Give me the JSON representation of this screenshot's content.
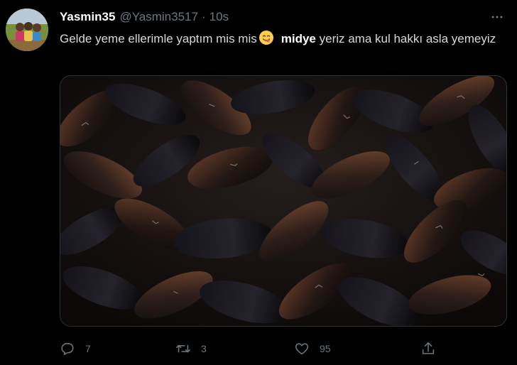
{
  "tweet": {
    "display_name": "Yasmin35",
    "handle": "@Yasmin3517",
    "separator": "·",
    "time": "10s",
    "text_part1": "Gelde yeme ellerimle yaptım mis mis",
    "text_bold": "midye",
    "text_part2": " yeriz ama kul hakkı asla yemeyiz"
  },
  "actions": {
    "reply_count": "7",
    "retweet_count": "3",
    "like_count": "95"
  },
  "icons": {
    "avatar": "children-photo-avatar",
    "more": "more-dots-icon",
    "emoji": "face-savoring-food-emoji",
    "reply": "reply-icon",
    "retweet": "retweet-icon",
    "like": "heart-icon",
    "share": "share-icon"
  },
  "colors": {
    "background": "#000000",
    "text": "#d9d9d9",
    "muted": "#6e767d",
    "border": "#2f3336"
  }
}
